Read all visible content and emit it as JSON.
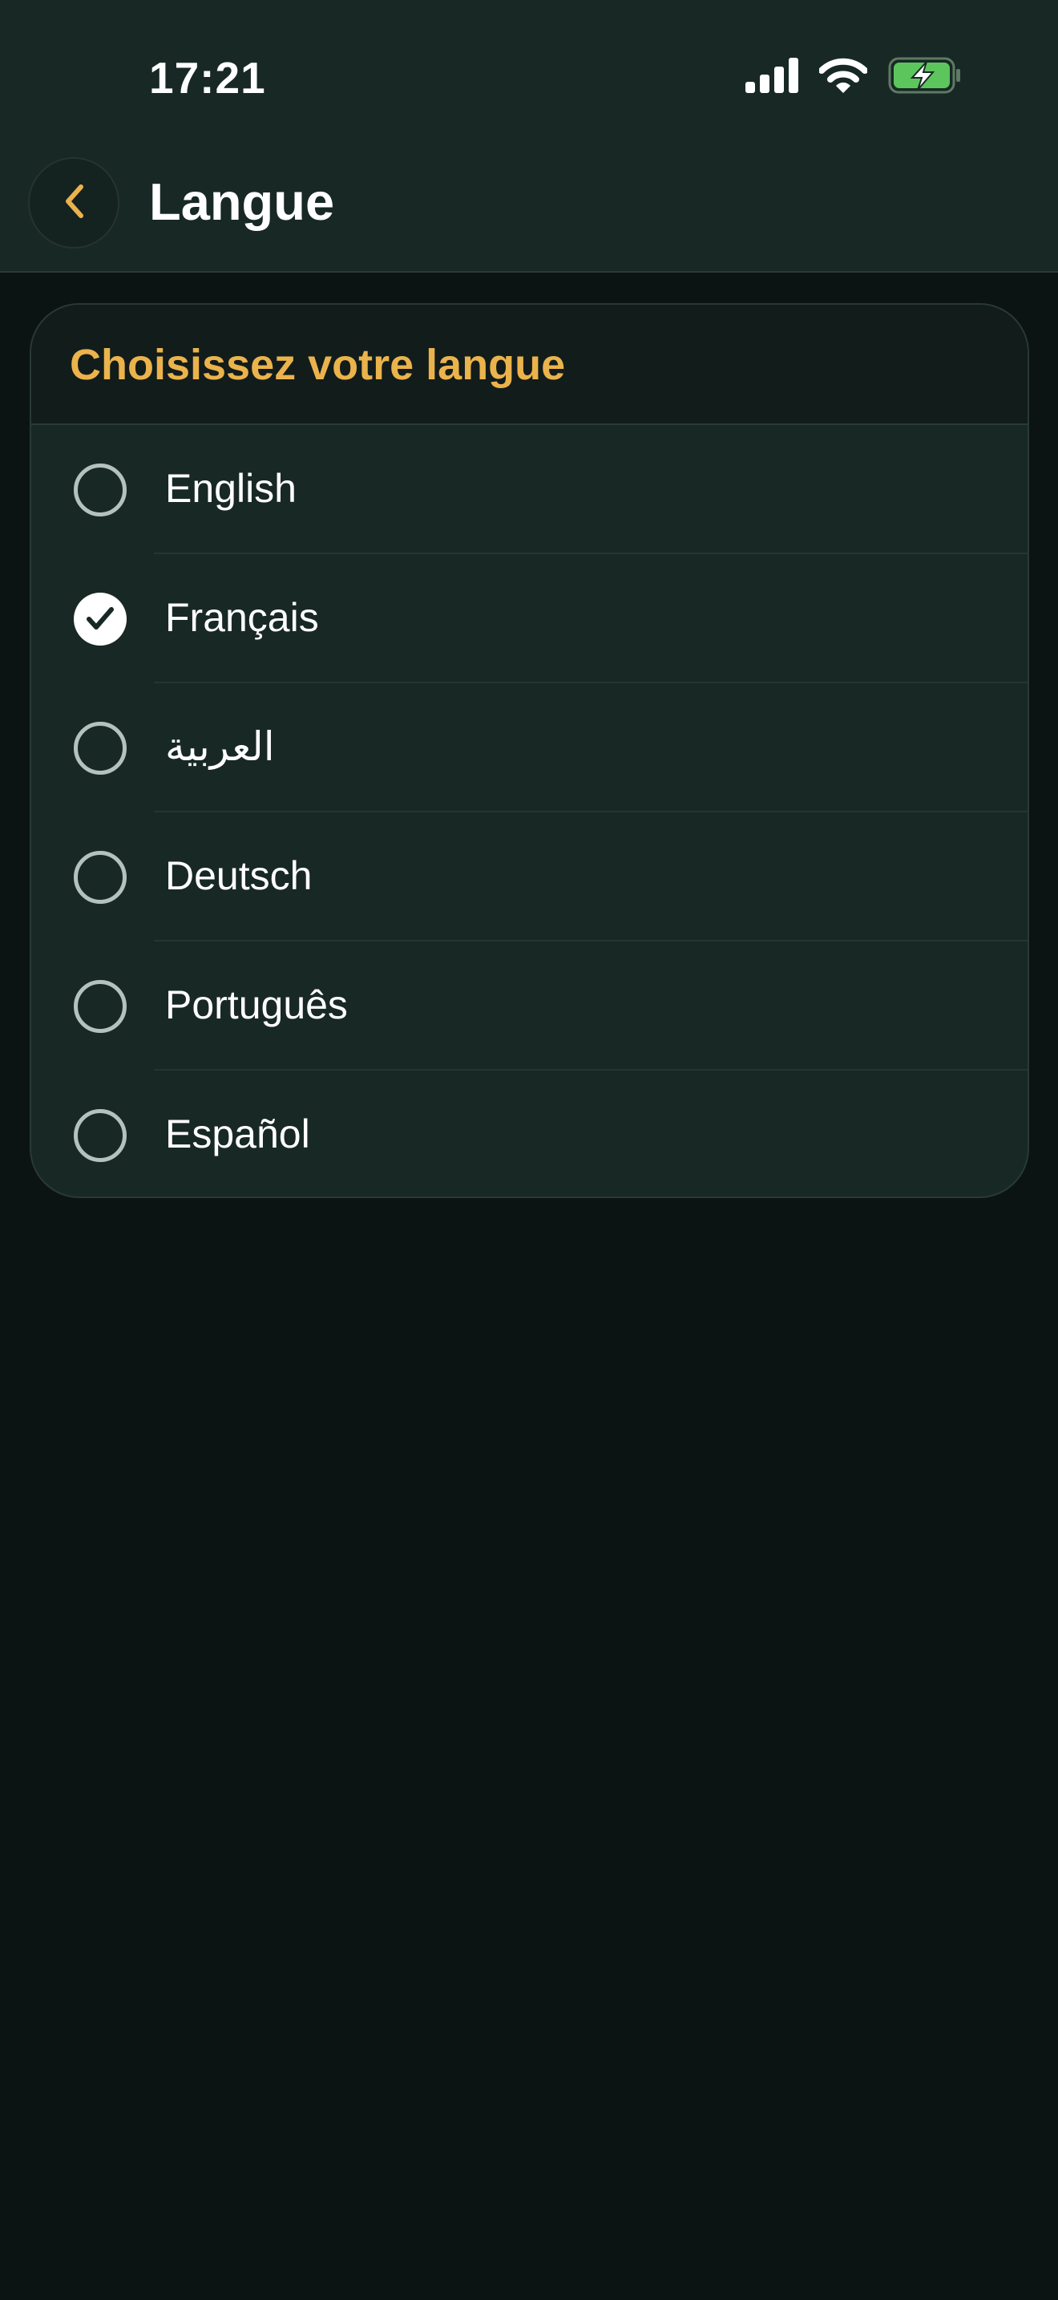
{
  "status_bar": {
    "time": "17:21",
    "icons": [
      "cellular-signal-icon",
      "wifi-icon",
      "battery-charging-icon"
    ]
  },
  "header": {
    "back_icon": "chevron-left-icon",
    "title": "Langue"
  },
  "language_card": {
    "title": "Choisissez votre langue",
    "selected": "Français",
    "options": [
      {
        "label": "English",
        "checked": false
      },
      {
        "label": "Français",
        "checked": true
      },
      {
        "label": "العربية",
        "checked": false
      },
      {
        "label": "Deutsch",
        "checked": false
      },
      {
        "label": "Português",
        "checked": false
      },
      {
        "label": "Español",
        "checked": false
      }
    ]
  },
  "colors": {
    "background": "#0c1413",
    "surface": "#182825",
    "accent": "#ebb34c",
    "battery_fill": "#5cc65c"
  }
}
